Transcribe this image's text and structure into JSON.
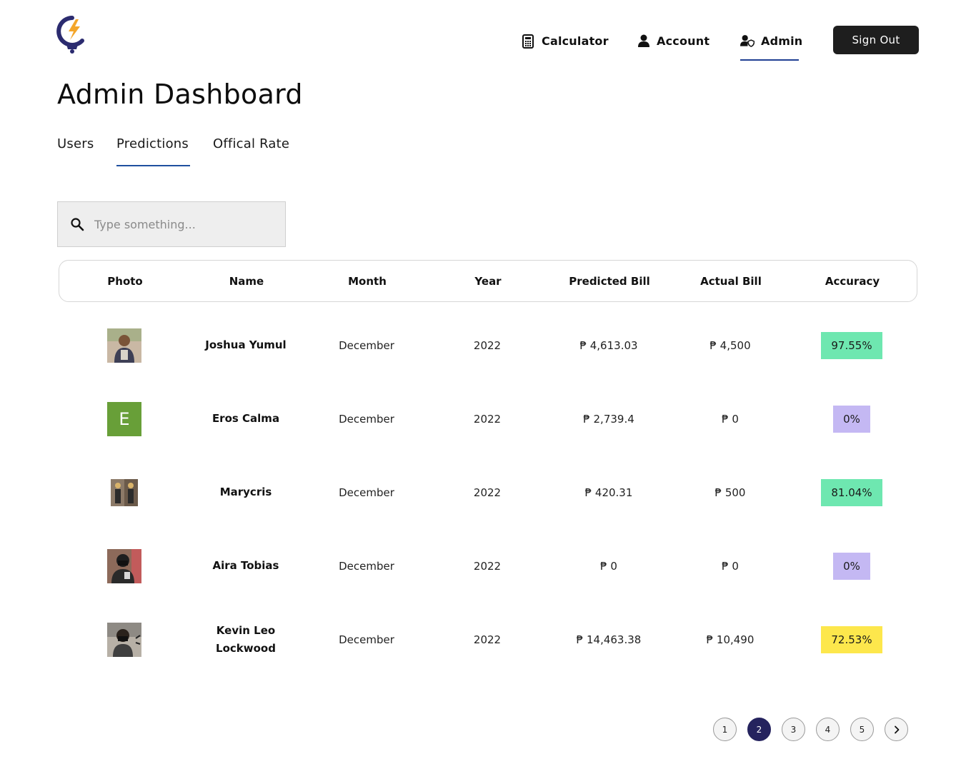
{
  "nav": {
    "calculator": "Calculator",
    "account": "Account",
    "admin": "Admin",
    "sign_out": "Sign Out"
  },
  "page_title": "Admin Dashboard",
  "tabs": [
    {
      "label": "Users",
      "active": false
    },
    {
      "label": "Predictions",
      "active": true
    },
    {
      "label": "Offical Rate",
      "active": false
    }
  ],
  "search": {
    "placeholder": "Type something..."
  },
  "table": {
    "columns": [
      "Photo",
      "Name",
      "Month",
      "Year",
      "Predicted Bill",
      "Actual Bill",
      "Accuracy"
    ],
    "rows": [
      {
        "name": "Joshua Yumul",
        "month": "December",
        "year": "2022",
        "predicted": "₱ 4,613.03",
        "actual": "₱ 4,500",
        "accuracy": "97.55%",
        "accuracy_color": "#6ee7b0"
      },
      {
        "name": "Eros Calma",
        "avatar_letter": "E",
        "month": "December",
        "year": "2022",
        "predicted": "₱ 2,739.4",
        "actual": "₱ 0",
        "accuracy": "0%",
        "accuracy_color": "#c4b8f3"
      },
      {
        "name": "Marycris",
        "month": "December",
        "year": "2022",
        "predicted": "₱ 420.31",
        "actual": "₱ 500",
        "accuracy": "81.04%",
        "accuracy_color": "#6ee7b0"
      },
      {
        "name": "Aira Tobias",
        "month": "December",
        "year": "2022",
        "predicted": "₱ 0",
        "actual": "₱ 0",
        "accuracy": "0%",
        "accuracy_color": "#c4b8f3"
      },
      {
        "name": "Kevin Leo Lockwood",
        "month": "December",
        "year": "2022",
        "predicted": "₱ 14,463.38",
        "actual": "₱ 10,490",
        "accuracy": "72.53%",
        "accuracy_color": "#fde74c"
      }
    ]
  },
  "pagination": {
    "pages": [
      "1",
      "2",
      "3",
      "4",
      "5"
    ],
    "current": "2"
  },
  "colors": {
    "accent": "#1f3f93",
    "active_page": "#25235e",
    "sign_out_bg": "#1e1e1e"
  }
}
